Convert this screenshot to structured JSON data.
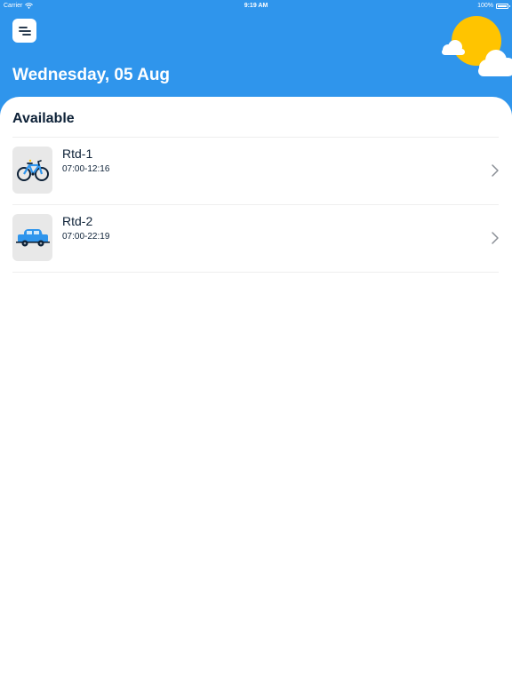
{
  "status_bar": {
    "carrier": "Carrier",
    "time": "9:19 AM",
    "battery": "100%",
    "battery_level": 1.0,
    "wifi_icon": "wifi-icon",
    "battery_icon": "battery-icon"
  },
  "header": {
    "date": "Wednesday, 05 Aug",
    "menu_icon": "menu-icon",
    "weather_icon": "sun-cloud-icon",
    "background_color": "#2f95ec"
  },
  "section": {
    "title": "Available"
  },
  "items": [
    {
      "name": "Rtd-1",
      "time": "07:00-12:16",
      "icon": "bicycle-icon"
    },
    {
      "name": "Rtd-2",
      "time": "07:00-22:19",
      "icon": "car-icon"
    }
  ],
  "colors": {
    "accent": "#2f95ec",
    "sun": "#ffc400",
    "text": "#0d2137"
  }
}
